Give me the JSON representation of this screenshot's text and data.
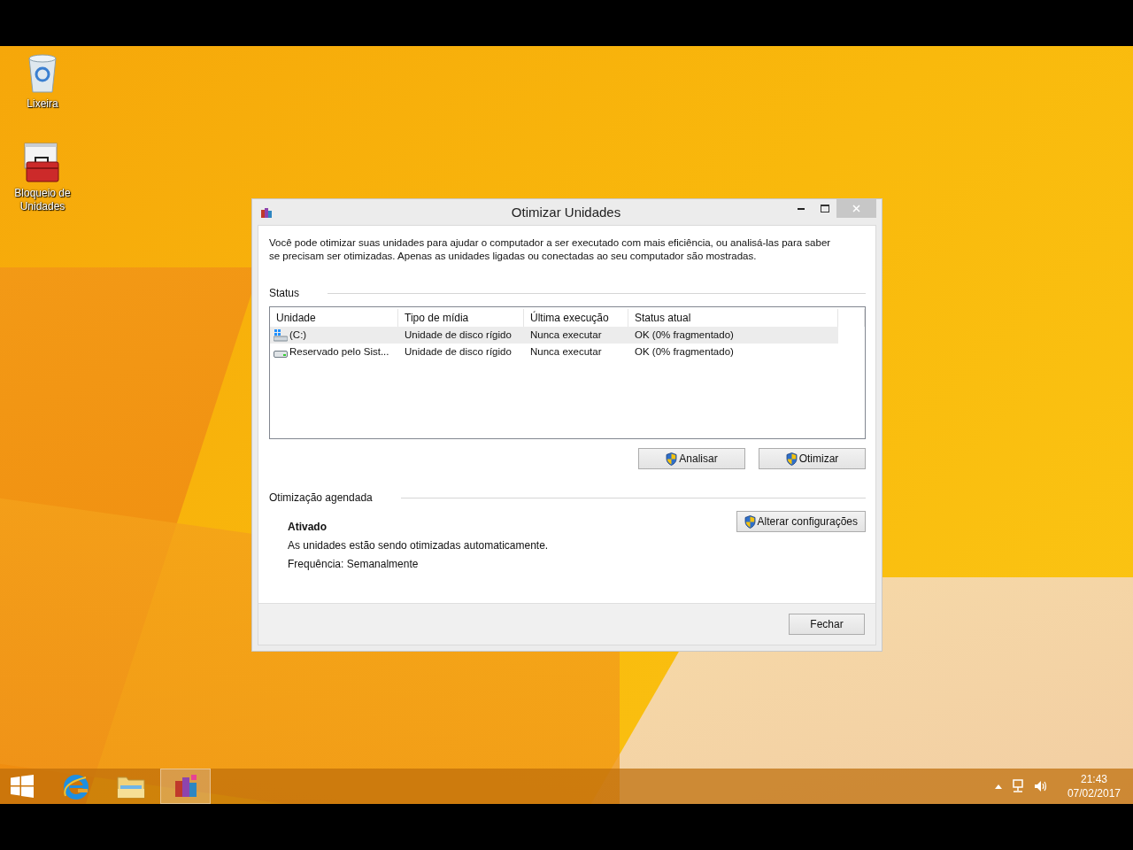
{
  "desktop_icons": [
    {
      "kind": "recycle-bin",
      "label": "Lixeira"
    },
    {
      "kind": "toolbox",
      "label": "Bloqueio de Unidades"
    }
  ],
  "window": {
    "title": "Otimizar Unidades",
    "intro": "Você pode otimizar suas unidades para ajudar o computador a ser executado com mais eficiência, ou analisá-las para saber se precisam ser otimizadas. Apenas as unidades ligadas ou conectadas ao seu computador são mostradas.",
    "status_label": "Status",
    "table": {
      "columns": [
        "Unidade",
        "Tipo de mídia",
        "Última execução",
        "Status atual"
      ],
      "rows": [
        {
          "kind": "system-drive",
          "selected": true,
          "cells": [
            "(C:)",
            "Unidade de disco rígido",
            "Nunca executar",
            "OK (0% fragmentado)"
          ]
        },
        {
          "kind": "drive",
          "selected": false,
          "cells": [
            "Reservado pelo Sist...",
            "Unidade de disco rígido",
            "Nunca executar",
            "OK (0% fragmentado)"
          ]
        }
      ]
    },
    "action_buttons": [
      "Analisar",
      "Otimizar"
    ],
    "schedule": {
      "label": "Otimização agendada",
      "state": "Ativado",
      "description": "As unidades estão sendo otimizadas automaticamente.",
      "frequency": "Frequência: Semanalmente",
      "button": "Alterar configurações"
    },
    "close_button": "Fechar"
  },
  "taskbar": {
    "apps": [
      {
        "kind": "browser",
        "selected": false
      },
      {
        "kind": "folder",
        "selected": false
      },
      {
        "kind": "defrag",
        "selected": true
      }
    ],
    "time": "21:43",
    "date": "07/02/2017"
  }
}
